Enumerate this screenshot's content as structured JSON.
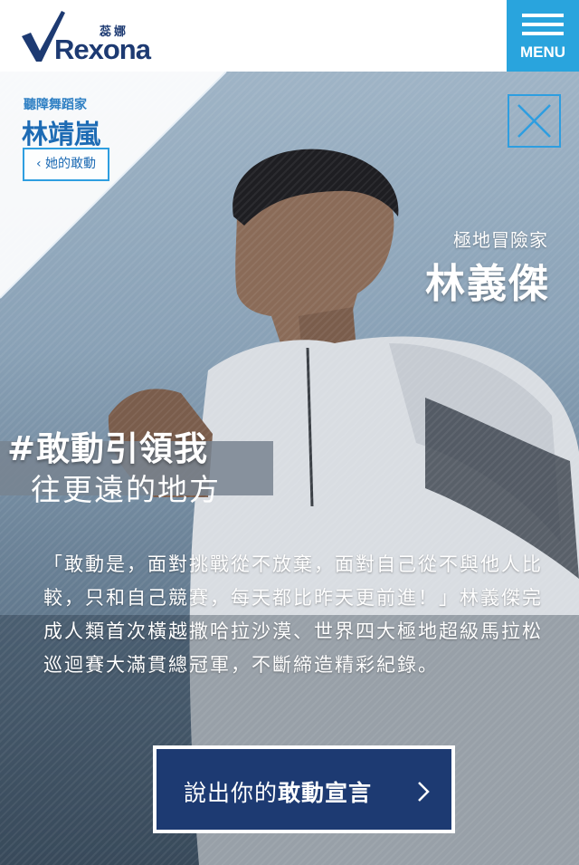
{
  "header": {
    "logo_sub": "蕊娜",
    "logo_word": "Rexona",
    "menu_label": "MENU"
  },
  "prev_athlete": {
    "role": "聽障舞蹈家",
    "name": "林靖嵐",
    "button_label": "她的敢動"
  },
  "athlete": {
    "role": "極地冒險家",
    "name": "林義傑"
  },
  "slogan": {
    "hashtag": "#敢動引領我",
    "tagline": "往更遠的地方"
  },
  "quote": "「敢動是，面對挑戰從不放棄，面對自己從不與他人比較，只和自己競賽，每天都比昨天更前進！」林義傑完成人類首次橫越撒哈拉沙漠、世界四大極地超級馬拉松巡迴賽大滿貫總冠軍，不斷締造精彩紀錄。",
  "cta": {
    "label_prefix": "說出你的",
    "label_bold": "敢動宣言"
  },
  "icons": {
    "logo": "rexona-check-logo-icon",
    "menu": "hamburger-icon",
    "close": "close-icon",
    "back": "chevron-left-icon",
    "cta_arrow": "chevron-right-icon"
  },
  "colors": {
    "brand_navy": "#1d3a72",
    "accent_blue": "#29a4dd",
    "outline_blue": "#2e9ee0"
  }
}
